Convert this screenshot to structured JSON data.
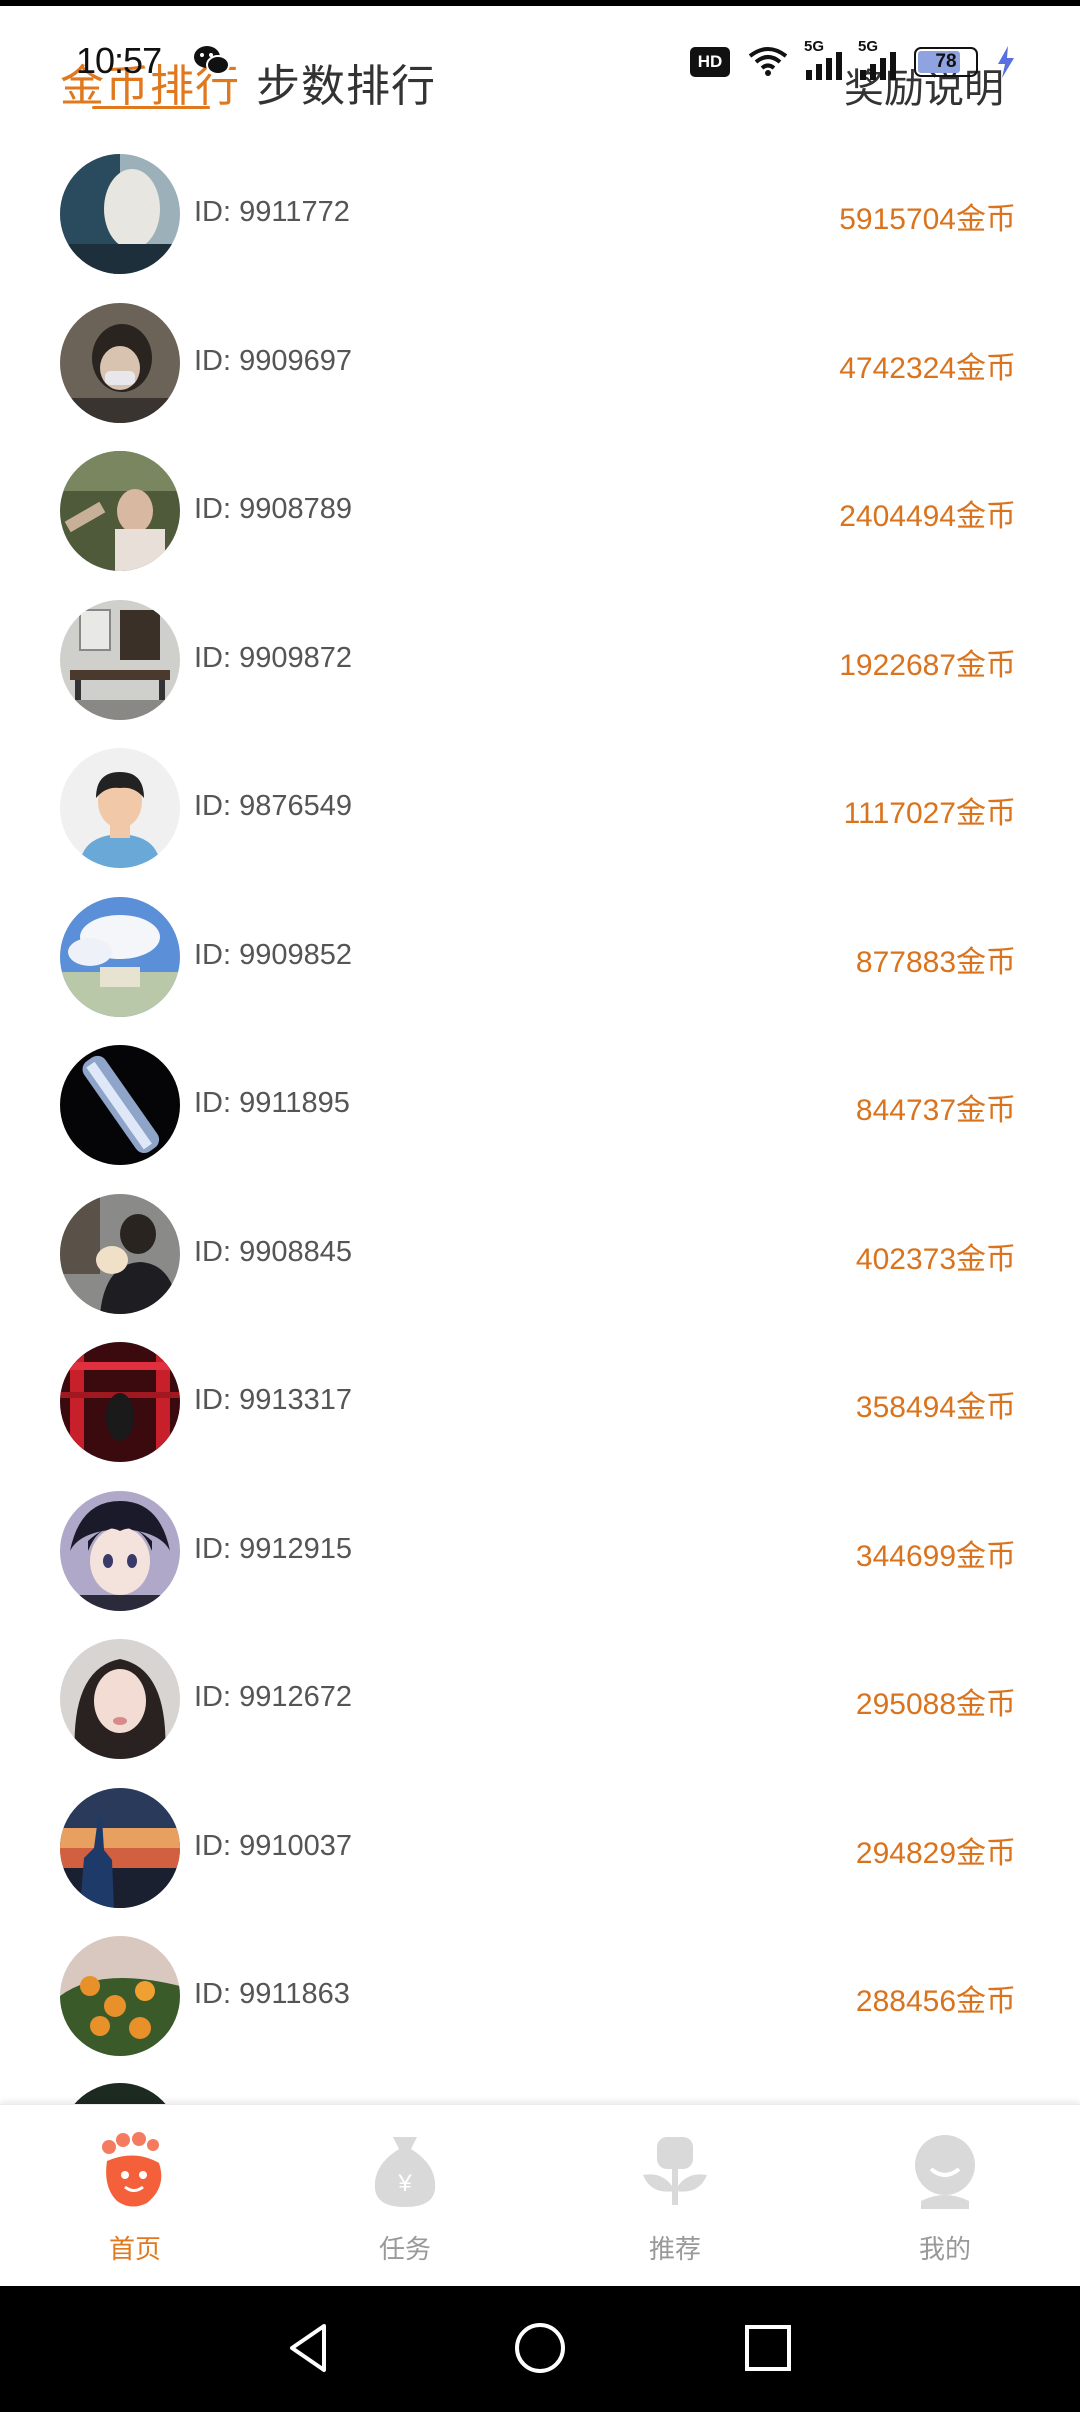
{
  "status_bar": {
    "time": "10:57",
    "hd_label": "HD",
    "network_label_1": "5G",
    "network_label_2": "5G",
    "battery": "78"
  },
  "header": {
    "tab_coin": "金币排行",
    "tab_steps": "步数排行",
    "reward_link": "奖励说明"
  },
  "rankings": [
    {
      "id": "ID: 9911772",
      "coins": "5915704金币"
    },
    {
      "id": "ID: 9909697",
      "coins": "4742324金币"
    },
    {
      "id": "ID: 9908789",
      "coins": "2404494金币"
    },
    {
      "id": "ID: 9909872",
      "coins": "1922687金币"
    },
    {
      "id": "ID: 9876549",
      "coins": "1117027金币"
    },
    {
      "id": "ID: 9909852",
      "coins": "877883金币"
    },
    {
      "id": "ID: 9911895",
      "coins": "844737金币"
    },
    {
      "id": "ID: 9908845",
      "coins": "402373金币"
    },
    {
      "id": "ID: 9913317",
      "coins": "358494金币"
    },
    {
      "id": "ID: 9912915",
      "coins": "344699金币"
    },
    {
      "id": "ID: 9912672",
      "coins": "295088金币"
    },
    {
      "id": "ID: 9910037",
      "coins": "294829金币"
    },
    {
      "id": "ID: 9911863",
      "coins": "288456金币"
    }
  ],
  "bottom_nav": [
    {
      "label": "首页",
      "icon": "footprint-icon",
      "active": true
    },
    {
      "label": "任务",
      "icon": "money-bag-icon",
      "active": false
    },
    {
      "label": "推荐",
      "icon": "flower-icon",
      "active": false
    },
    {
      "label": "我的",
      "icon": "profile-icon",
      "active": false
    }
  ],
  "colors": {
    "accent": "#e0781e",
    "coin_text": "#d9731d",
    "inactive_nav": "#cccccc"
  }
}
